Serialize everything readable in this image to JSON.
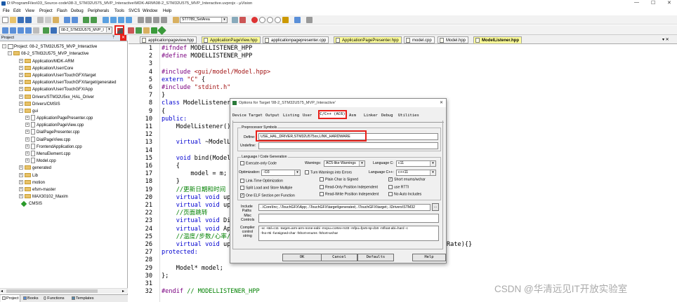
{
  "window": {
    "title": "D:\\ProgramFiles\\03_Source-code\\08-3_STM32U575_MVP_Interactive\\MDK-ARM\\08-2_STM32U575_MVP_Interactive.uvprojx - µVision",
    "min": "—",
    "max": "☐",
    "close": "✕"
  },
  "menu": [
    "File",
    "Edit",
    "View",
    "Project",
    "Flash",
    "Debug",
    "Peripherals",
    "Tools",
    "SVCS",
    "Window",
    "Help"
  ],
  "toolbar": {
    "find_combo": "ST7789_SetArea",
    "target_combo": "08-2_STM32U575_MVP_I"
  },
  "project": {
    "header": "Project",
    "pin": "ᛘ",
    "close": "✕",
    "root": "Project: 08-2_STM32U575_MVP_Interactive",
    "target": "08-2_STM32U575_MVP_Interactive",
    "folders": [
      "Application/MDK-ARM",
      "Application/User/Core",
      "Application/User/TouchGFX/target",
      "Application/User/TouchGFX/target/generated",
      "Application/User/TouchGFX/App",
      "Drivers/STM32U5xx_HAL_Driver",
      "Drivers/CMSIS",
      "gui"
    ],
    "gui_files": [
      "ApplicationPagePresenter.cpp",
      "ApplicationPageView.cpp",
      "DialPagePresenter.cpp",
      "DialPageView.cpp",
      "FrontendApplication.cpp",
      "MenuElement.cpp",
      "Model.cpp"
    ],
    "after": [
      "generated",
      "Lib",
      "motion",
      "efsm-master",
      "MAX30102_Maxim",
      "CMSIS"
    ]
  },
  "bottom_tabs": [
    "Project",
    "Books",
    "Functions",
    "Templates"
  ],
  "editor": {
    "tabs": [
      "applicationpageview.hpp",
      "ApplicationPageView.hpp",
      "applicationpagepresenter.cpp",
      "ApplicationPagePresenter.hpp",
      "model.cpp",
      "Model.hpp",
      "ModelListener.hpp"
    ],
    "tab_menu": "▾ ✕",
    "line_numbers": [
      "1",
      "2",
      "3",
      "4",
      "5",
      "6",
      "7",
      "8",
      "9",
      "10",
      "11",
      "12",
      "13",
      "14",
      "15",
      "16",
      "17",
      "18",
      "19",
      "20",
      "21",
      "22",
      "23",
      "24",
      "25",
      "26",
      "27",
      "28",
      "29",
      "30",
      "31",
      "32"
    ],
    "code": {
      "l1a": "#ifndef",
      "l1b": " MODELLISTENER_HPP",
      "l2a": "#define",
      "l2b": " MODELLISTENER_HPP",
      "l4a": "#include",
      "l4b": " <gui/model/Model.hpp>",
      "l5a": "extern",
      "l5b": " \"C\"",
      "l5c": " {",
      "l6a": "#include",
      "l6b": " \"stdint.h\"",
      "l7": "}",
      "l8a": "class",
      "l8b": " ModelListener",
      "l9": "{",
      "l10a": "public:",
      "l11": "    ModelListener() :",
      "l13a": "    virtual",
      "l13b": " ~ModelLis",
      "l15a": "    void",
      "l15b": " bind(Model*",
      "l16": "    {",
      "l17": "        model = m;",
      "l18": "    }",
      "l19": "    //更新日期和时间",
      "l20a": "    virtual void",
      "l20b": " upda",
      "l21a": "    virtual void",
      "l21b": " upda",
      "l22": "    //页面跳转",
      "l23a": "    virtual void",
      "l23b": " Dial",
      "l24a": "    virtual void",
      "l24b": " AppP",
      "l25": "    //温度/步数/心率/",
      "l26a": "    virtual void",
      "l26b": " upda",
      "l26c": "Rate){}",
      "l28a": "protected:",
      "l29": "    Model* model;",
      "l30": "};",
      "l32a": "#endif",
      "l32b": " // MODELLISTENER_HPP"
    }
  },
  "dialog": {
    "title": "Options for Target '08-2_STM32U575_MVP_Interactive'",
    "close": "✕",
    "tabs": [
      "Device",
      "Target",
      "Output",
      "Listing",
      "User",
      "C/C++ (AC6)",
      "Asm",
      "Linker",
      "Debug",
      "Utilities"
    ],
    "pre": {
      "group": "Preprocessor Symbols",
      "define_label": "Define:",
      "define_value": "USE_HAL_DRIVER,STM32U575xx,LINK_HARDWARE",
      "undefine_label": "Undefine:",
      "undefine_value": ""
    },
    "lang": {
      "group": "Language / Code Generation",
      "execute_only": "Execute-only Code",
      "warnings_label": "Warnings:",
      "warnings_value": "AC5-like Warnings",
      "lang_c_label": "Language C:",
      "lang_c_value": "c11",
      "opt_label": "Optimization:",
      "opt_value": "-O3",
      "turn_warnings": "Turn Warnings into Errors",
      "lang_cpp_label": "Language C++:",
      "lang_cpp_value": "c++11",
      "link_time": "Link-Time Optimization",
      "plain_char": "Plain Char is Signed",
      "short_enums": "Short enums/wchar",
      "split_load": "Split Load and Store Multiple",
      "ropi": "Read-Only Position Independent",
      "use_rtti": "use RTTI",
      "one_elf": "One ELF Section per Function",
      "rwpi": "Read-Write Position Independent",
      "no_auto": "No Auto Includes"
    },
    "include_label": "Include\nPaths",
    "include_value": "..\\Core\\Inc;..\\TouchGFX\\App;..\\TouchGFX\\target\\generated;..\\TouchGFX\\target;..\\Drivers\\STM32",
    "browse": "...",
    "misc_label": "Misc\nControls",
    "misc_value": "",
    "compiler_label": "Compiler\ncontrol\nstring",
    "compiler_value": "-xc -std=c11 -target=arm-arm-none-eabi -mcpu=cortex-m33 -mfpu=fpv5-sp-d16 -mfloat-abi=hard -c\n-fno-rtti -funsigned-char -fshort-enums -fshort-wchar",
    "buttons": [
      "OK",
      "Cancel",
      "Defaults",
      "Help"
    ]
  },
  "watermark": "CSDN @华清远见IT开放实验室",
  "colors": {
    "highlight": "#e8201a",
    "tab_active": "#ffff99"
  }
}
